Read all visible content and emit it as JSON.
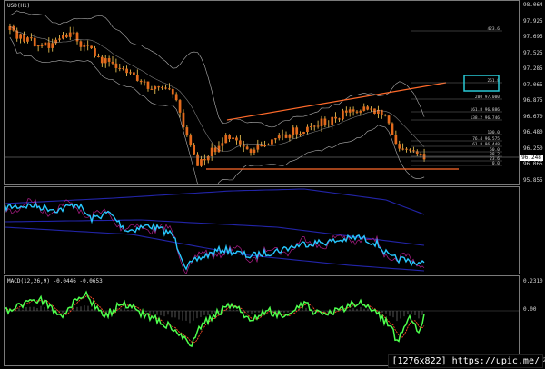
{
  "panes": {
    "main": {
      "title": "USD(H1)",
      "scale": [
        "98.064",
        "97.925",
        "97.695",
        "97.525",
        "97.285",
        "97.065",
        "96.875",
        "96.670",
        "96.480",
        "96.250",
        "96.065",
        "95.855"
      ],
      "price_label": "96.248"
    },
    "mid": {
      "title": "",
      "scale": []
    },
    "macd": {
      "title": "MACD(12,26,9) -0.0446 -0.0653",
      "scale": [
        "0.2310",
        "0.00",
        "-0.2962"
      ]
    }
  },
  "fib_labels": [
    "423.6",
    "261.8",
    "200 97.000",
    "161.8 96.886",
    "138.2 96.746",
    "100.0",
    "76.4 96.575",
    "61.8 96.448",
    "50.0",
    "38.2",
    "23.6",
    "0.0"
  ],
  "watermark": "[1276x822] https://upic.me/",
  "colors": {
    "background": "#000000",
    "candle": "#e36a1c",
    "wick": "#ffd35a",
    "bollinger": "#cfcfcf",
    "trendline": "#ff6a2a",
    "highlight_box": "#29c9d6",
    "osc_main": "#27c8ff",
    "osc_band": "#2224a8",
    "osc_signal": "#b01e8a",
    "macd_line": "#4dff4d",
    "macd_signal": "#ff4a2a",
    "price_label_bg": "#ffffff"
  }
}
